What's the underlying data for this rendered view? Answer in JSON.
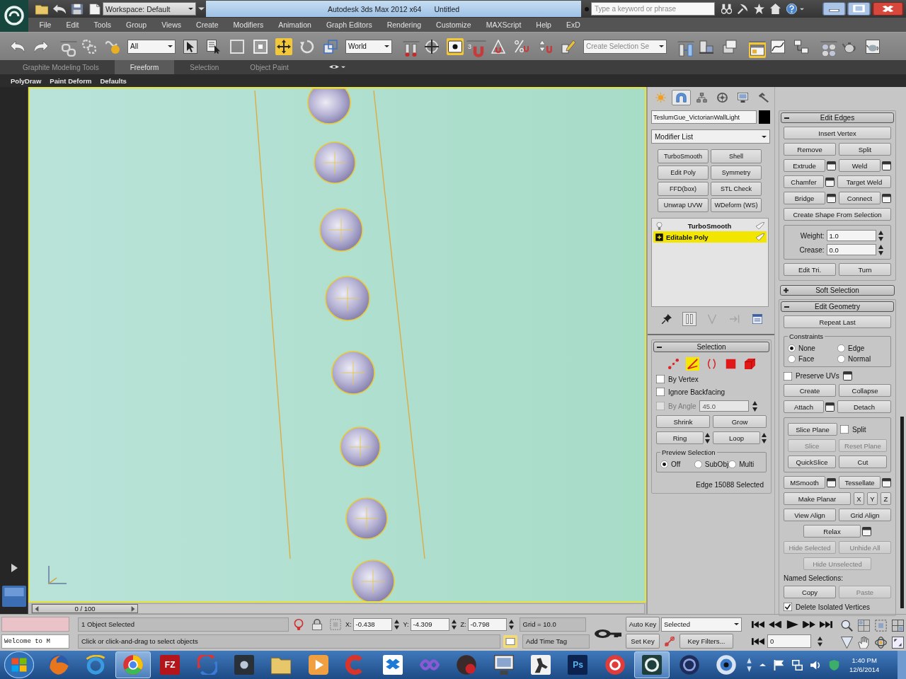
{
  "title_bar": {
    "workspace": "Workspace: Default",
    "title": "Autodesk 3ds Max 2012 x64",
    "document": "Untitled",
    "search": {
      "placeholder": "Type a keyword or phrase"
    }
  },
  "menu_bar": [
    "File",
    "Edit",
    "Tools",
    "Group",
    "Views",
    "Create",
    "Modifiers",
    "Animation",
    "Graph Editors",
    "Rendering",
    "Customize",
    "MAXScript",
    "Help",
    "ExD"
  ],
  "main_toolbar": [
    {
      "kind": "tool",
      "selected": false
    },
    {
      "kind": "tool",
      "selected": false
    },
    {
      "kind": "tool",
      "selected": false
    },
    {
      "kind": "tool",
      "selected": false
    },
    {
      "kind": "tool",
      "selected": false
    },
    {
      "kind": "dropdown",
      "value": "All"
    },
    {
      "kind": "tool",
      "selected": false
    },
    {
      "kind": "tool",
      "selected": false
    },
    {
      "kind": "tool",
      "selected": false
    },
    {
      "kind": "tool",
      "selected": false
    },
    {
      "kind": "tool",
      "selected": true
    },
    {
      "kind": "tool",
      "selected": false
    },
    {
      "kind": "tool",
      "selected": false
    },
    {
      "kind": "dropdown",
      "value": "World"
    },
    {
      "kind": "tool",
      "selected": false
    },
    {
      "kind": "tool",
      "selected": false
    },
    {
      "kind": "tool",
      "selected": true
    },
    {
      "kind": "tool",
      "selected": false,
      "badge": "3"
    },
    {
      "kind": "tool",
      "selected": false
    },
    {
      "kind": "tool",
      "selected": false
    },
    {
      "kind": "tool",
      "selected": false
    },
    {
      "kind": "tool",
      "selected": false
    },
    {
      "kind": "dropdown",
      "value": "Create Selection Se"
    },
    {
      "kind": "tool",
      "selected": false
    },
    {
      "kind": "tool",
      "selected": false
    },
    {
      "kind": "tool",
      "selected": false
    },
    {
      "kind": "tool",
      "selected": true
    },
    {
      "kind": "tool",
      "selected": false
    },
    {
      "kind": "tool",
      "selected": false
    },
    {
      "kind": "tool",
      "selected": false
    },
    {
      "kind": "tool",
      "selected": false
    },
    {
      "kind": "tool",
      "selected": false
    }
  ],
  "ribbon": {
    "tabs": [
      {
        "label": "Graphite Modeling Tools",
        "selected": false
      },
      {
        "label": "Freeform",
        "selected": true
      },
      {
        "label": "Selection",
        "selected": false
      },
      {
        "label": "Object Paint",
        "selected": false
      }
    ],
    "panel_items": [
      "PolyDraw",
      "Paint Deform",
      "Defaults"
    ]
  },
  "time_slider": {
    "label": "0 / 100",
    "level": 0
  },
  "command_panel": {
    "tabs": [
      {
        "selected": false
      },
      {
        "selected": true
      },
      {
        "selected": false
      },
      {
        "selected": false
      },
      {
        "selected": false
      },
      {
        "selected": false
      }
    ],
    "object_name": "TeslumGue_VictorianWallLight",
    "modifier_list": "Modifier List",
    "modifier_buttons": [
      "TurboSmooth",
      "Shell",
      "Edit Poly",
      "Symmetry",
      "FFD(box)",
      "STL Check",
      "Unwrap UVW",
      "WDeform (WS)"
    ],
    "stack": [
      {
        "kind": "modifier",
        "label": "TurboSmooth",
        "selected": false
      },
      {
        "kind": "object",
        "label": "Editable Poly",
        "selected": true
      }
    ],
    "stack_tools": [
      {
        "selected": false,
        "disabled": false
      },
      {
        "selected": true,
        "disabled": false
      },
      {
        "selected": false,
        "disabled": true
      },
      {
        "selected": false,
        "disabled": true
      },
      {
        "selected": false,
        "disabled": false
      }
    ],
    "rollouts": [
      {
        "title": "Selection",
        "expanded": true,
        "rows": [
          {
            "kind": "subobjects",
            "items": [
              {
                "selected": false
              },
              {
                "selected": true
              },
              {
                "selected": false
              },
              {
                "selected": false
              },
              {
                "selected": false
              }
            ]
          },
          {
            "kind": "checkbox",
            "label": "By Vertex",
            "checked": false,
            "disabled": false
          },
          {
            "kind": "checkbox",
            "label": "Ignore Backfacing",
            "checked": false,
            "disabled": false
          },
          {
            "kind": "checkbox_value",
            "label": "By Angle",
            "checked": false,
            "disabled": true,
            "value": "45.0"
          },
          {
            "kind": "buttons",
            "items": [
              {
                "kind": "plain",
                "label": "Shrink",
                "disabled": false
              },
              {
                "kind": "plain",
                "label": "Grow",
                "disabled": false
              }
            ]
          },
          {
            "kind": "buttons",
            "items": [
              {
                "kind": "spinner",
                "label": "Ring",
                "disabled": false
              },
              {
                "kind": "spinner",
                "label": "Loop",
                "disabled": false
              }
            ]
          },
          {
            "kind": "group",
            "title": "Preview Selection",
            "rows": [
              {
                "kind": "radios",
                "items": [
                  {
                    "label": "Off",
                    "selected": true
                  },
                  {
                    "label": "SubObj",
                    "selected": false
                  },
                  {
                    "label": "Multi",
                    "selected": false
                  }
                ]
              }
            ]
          },
          {
            "kind": "status",
            "text": "Edge 15088 Selected"
          }
        ]
      }
    ],
    "side_rollouts": [
      {
        "title": "Edit Edges",
        "expanded": true,
        "rows": [
          {
            "kind": "buttons",
            "items": [
              {
                "kind": "plain",
                "label": "Insert Vertex",
                "disabled": false
              }
            ]
          },
          {
            "kind": "buttons",
            "items": [
              {
                "kind": "plain",
                "label": "Remove",
                "disabled": false
              },
              {
                "kind": "plain",
                "label": "Split",
                "disabled": false
              }
            ]
          },
          {
            "kind": "buttons",
            "items": [
              {
                "kind": "settings",
                "label": "Extrude",
                "disabled": false
              },
              {
                "kind": "settings",
                "label": "Weld",
                "disabled": false
              }
            ]
          },
          {
            "kind": "buttons",
            "items": [
              {
                "kind": "settings",
                "label": "Chamfer",
                "disabled": false
              },
              {
                "kind": "plain",
                "label": "Target Weld",
                "disabled": false
              }
            ]
          },
          {
            "kind": "buttons",
            "items": [
              {
                "kind": "settings",
                "label": "Bridge",
                "disabled": false
              },
              {
                "kind": "settings",
                "label": "Connect",
                "disabled": false
              }
            ]
          },
          {
            "kind": "buttons",
            "items": [
              {
                "kind": "plain",
                "label": "Create Shape From Selection",
                "disabled": false
              }
            ]
          },
          {
            "kind": "group",
            "rows": [
              {
                "kind": "spinner",
                "label": "Weight:",
                "value": "1.0"
              },
              {
                "kind": "spinner",
                "label": "Crease:",
                "value": "0.0"
              }
            ]
          },
          {
            "kind": "buttons",
            "items": [
              {
                "kind": "plain",
                "label": "Edit Tri.",
                "disabled": false
              },
              {
                "kind": "plain",
                "label": "Turn",
                "disabled": false
              }
            ]
          }
        ]
      },
      {
        "title": "Soft Selection",
        "expanded": false
      },
      {
        "title": "Edit Geometry",
        "expanded": true,
        "rows": [
          {
            "kind": "buttons",
            "items": [
              {
                "kind": "plain",
                "label": "Repeat Last",
                "disabled": false
              }
            ]
          },
          {
            "kind": "group",
            "title": "Constraints",
            "rows": [
              {
                "kind": "radios",
                "items": [
                  {
                    "label": "None",
                    "selected": true
                  },
                  {
                    "label": "Edge",
                    "selected": false
                  }
                ]
              },
              {
                "kind": "radios",
                "items": [
                  {
                    "label": "Face",
                    "selected": false
                  },
                  {
                    "label": "Normal",
                    "selected": false
                  }
                ]
              }
            ]
          },
          {
            "kind": "checkbox_settings",
            "label": "Preserve UVs",
            "checked": false,
            "disabled": false
          },
          {
            "kind": "buttons",
            "items": [
              {
                "kind": "plain",
                "label": "Create",
                "disabled": false
              },
              {
                "kind": "plain",
                "label": "Collapse",
                "disabled": false
              }
            ]
          },
          {
            "kind": "buttons",
            "items": [
              {
                "kind": "settings",
                "label": "Attach",
                "disabled": false
              },
              {
                "kind": "plain",
                "label": "Detach",
                "disabled": false
              }
            ]
          },
          {
            "kind": "group",
            "rows": [
              {
                "kind": "buttons",
                "items": [
                  {
                    "kind": "plain",
                    "label": "Slice Plane",
                    "disabled": false
                  },
                  {
                    "kind": "checkbox",
                    "label": "Split",
                    "checked": false,
                    "disabled": false
                  }
                ]
              },
              {
                "kind": "buttons",
                "items": [
                  {
                    "kind": "plain",
                    "label": "Slice",
                    "disabled": true
                  },
                  {
                    "kind": "plain",
                    "label": "Reset Plane",
                    "disabled": true
                  }
                ]
              },
              {
                "kind": "buttons",
                "items": [
                  {
                    "kind": "plain",
                    "label": "QuickSlice",
                    "disabled": false
                  },
                  {
                    "kind": "plain",
                    "label": "Cut",
                    "disabled": false
                  }
                ]
              }
            ]
          },
          {
            "kind": "buttons",
            "items": [
              {
                "kind": "settings",
                "label": "MSmooth",
                "disabled": false
              },
              {
                "kind": "settings",
                "label": "Tessellate",
                "disabled": false
              }
            ]
          },
          {
            "kind": "buttons",
            "items": [
              {
                "kind": "plain",
                "label": "Make Planar",
                "disabled": false
              },
              {
                "kind": "axis",
                "label": "X",
                "disabled": false
              },
              {
                "kind": "axis",
                "label": "Y",
                "disabled": false
              },
              {
                "kind": "axis",
                "label": "Z",
                "disabled": false
              }
            ]
          },
          {
            "kind": "buttons",
            "items": [
              {
                "kind": "plain",
                "label": "View Align",
                "disabled": false
              },
              {
                "kind": "plain",
                "label": "Grid Align",
                "disabled": false
              }
            ]
          },
          {
            "kind": "centered",
            "items": [
              {
                "kind": "settings",
                "label": "Relax",
                "disabled": false
              }
            ]
          },
          {
            "kind": "buttons",
            "items": [
              {
                "kind": "plain",
                "label": "Hide Selected",
                "disabled": true
              },
              {
                "kind": "plain",
                "label": "Unhide All",
                "disabled": true
              }
            ]
          },
          {
            "kind": "centered",
            "items": [
              {
                "kind": "plain",
                "label": "Hide Unselected",
                "disabled": true
              }
            ]
          },
          {
            "kind": "label",
            "text": "Named Selections:"
          },
          {
            "kind": "buttons",
            "items": [
              {
                "kind": "plain",
                "label": "Copy",
                "disabled": false
              },
              {
                "kind": "plain",
                "label": "Paste",
                "disabled": true
              }
            ]
          },
          {
            "kind": "checkbox",
            "label": "Delete Isolated Vertices",
            "checked": true,
            "disabled": false
          }
        ]
      }
    ]
  },
  "status_bar": {
    "selection_info": "1 Object Selected",
    "listener_output": "Welcome to M",
    "prompt": "Click or click-and-drag to select objects",
    "coordinates": [
      {
        "axis": "X:",
        "value": "-0.438"
      },
      {
        "axis": "Y:",
        "value": "-4.309"
      },
      {
        "axis": "Z:",
        "value": "-0.798"
      }
    ],
    "grid": "Grid = 10.0",
    "time_tag": "Add Time Tag",
    "auto_key": "Auto Key",
    "key_target": "Selected",
    "set_key": "Set Key",
    "key_filters": "Key Filters...",
    "frame": "0"
  },
  "taskbar": {
    "apps": [
      {
        "selected": false
      },
      {
        "selected": false
      },
      {
        "selected": true
      },
      {
        "selected": false,
        "glyph": "FZ"
      },
      {
        "selected": false
      },
      {
        "selected": false
      },
      {
        "selected": false
      },
      {
        "selected": false
      },
      {
        "selected": false
      },
      {
        "selected": false
      },
      {
        "selected": false
      },
      {
        "selected": false
      },
      {
        "selected": false
      },
      {
        "selected": false
      },
      {
        "selected": false,
        "glyph": "Ps"
      },
      {
        "selected": false
      },
      {
        "selected": true
      },
      {
        "selected": false
      },
      {
        "selected": false
      }
    ],
    "clock": {
      "time": "1:40 PM",
      "date": "12/6/2014"
    }
  }
}
